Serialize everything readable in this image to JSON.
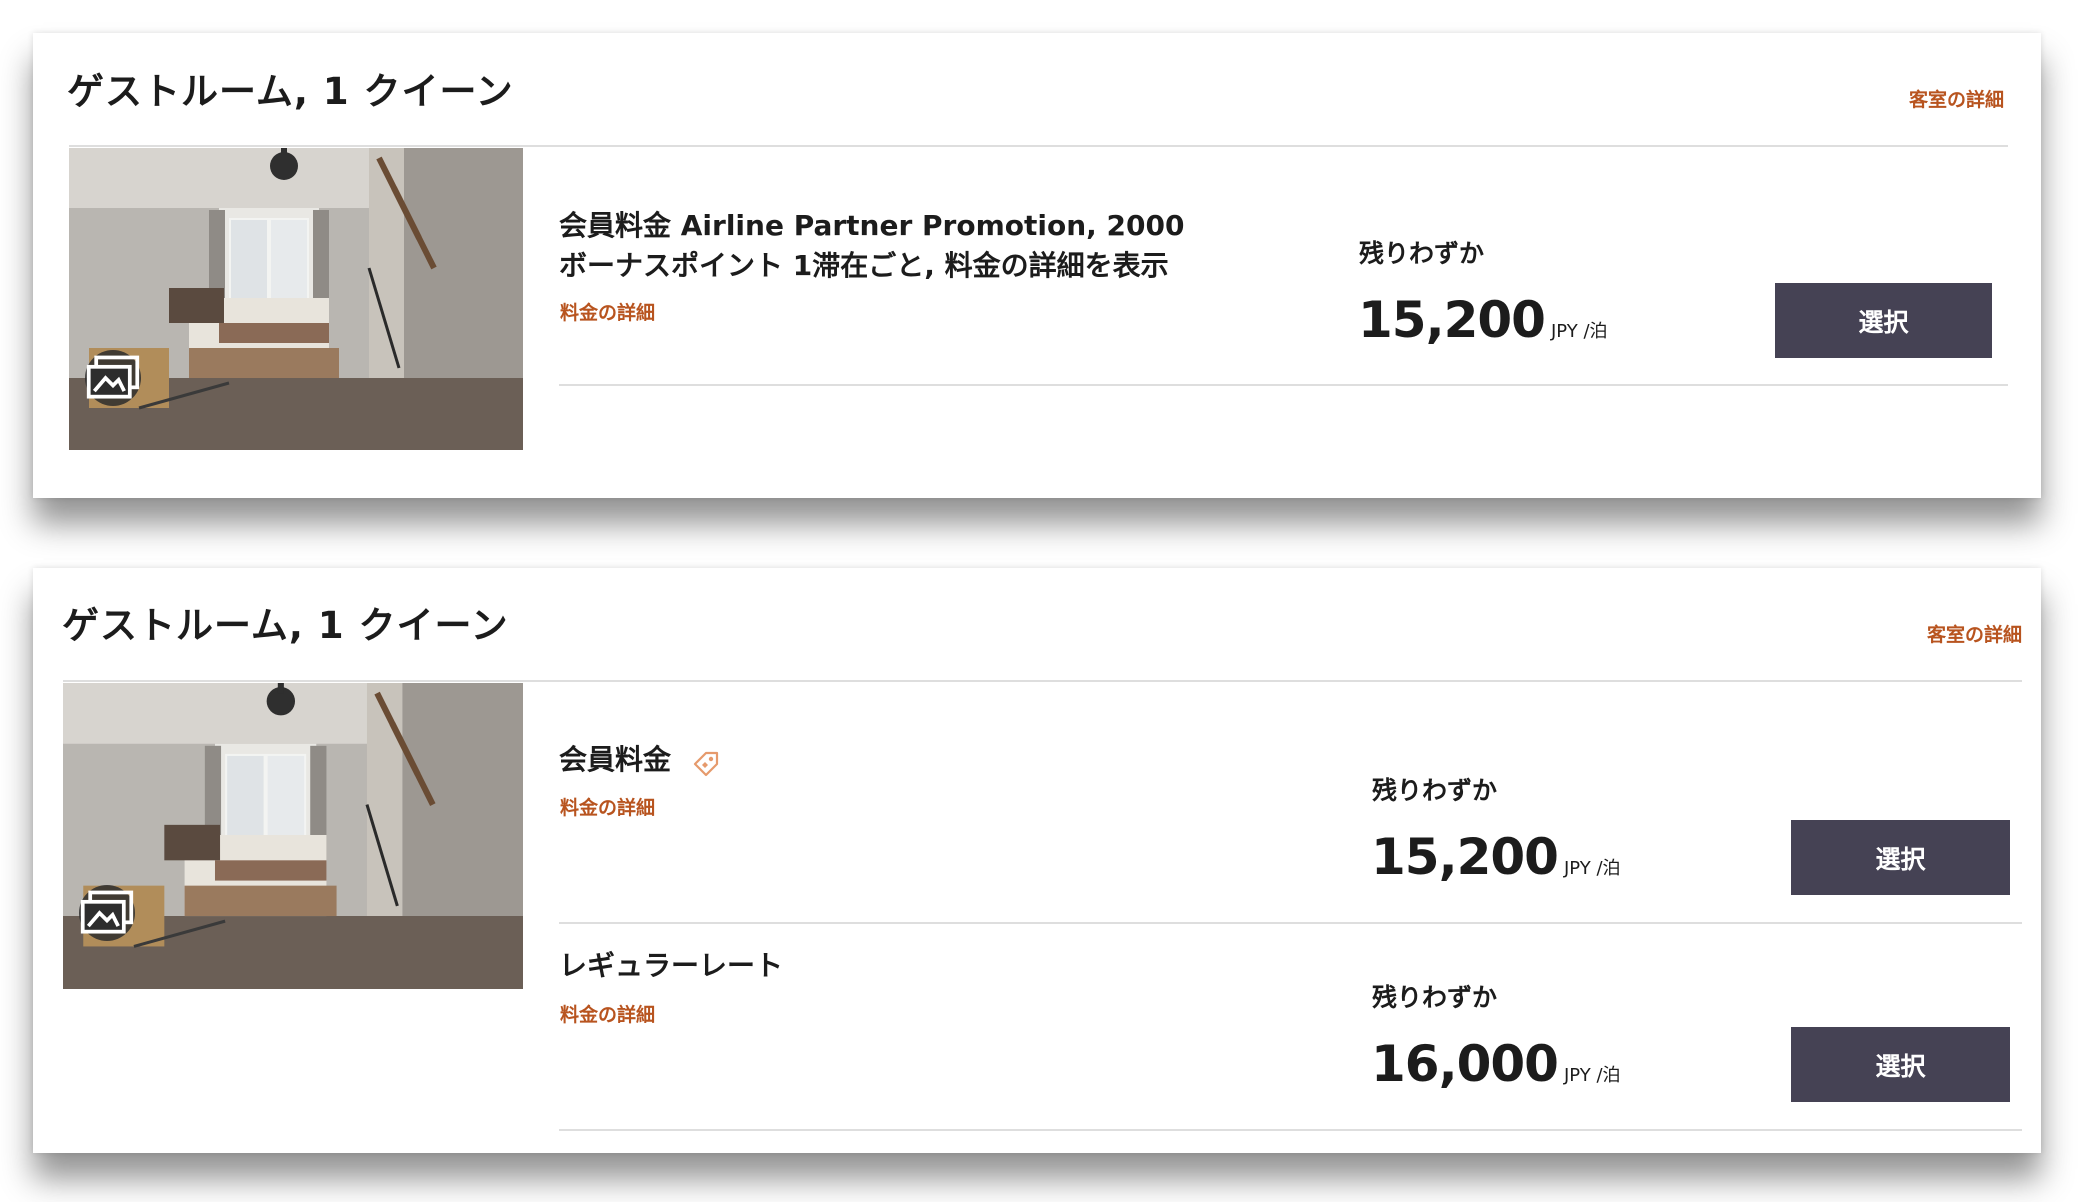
{
  "rooms": [
    {
      "title": "ゲストルーム, 1 クイーン",
      "details_link": "客室の詳細",
      "gallery_icon": "gallery-icon",
      "rates": [
        {
          "name": "会員料金 Airline Partner Promotion, 2000 ボーナスポイント 1滞在ごと, 料金の詳細を表示",
          "details_link": "料金の詳細",
          "availability": "残りわずか",
          "price": "15,200",
          "unit": "JPY /泊",
          "select_label": "選択"
        }
      ]
    },
    {
      "title": "ゲストルーム, 1 クイーン",
      "details_link": "客室の詳細",
      "gallery_icon": "gallery-icon",
      "rates": [
        {
          "name": "会員料金",
          "tag_icon": "member-tag-icon",
          "details_link": "料金の詳細",
          "availability": "残りわずか",
          "price": "15,200",
          "unit": "JPY /泊",
          "select_label": "選択"
        },
        {
          "name": "レギュラーレート",
          "details_link": "料金の詳細",
          "availability": "残りわずか",
          "price": "16,000",
          "unit": "JPY /泊",
          "select_label": "選択"
        }
      ]
    }
  ],
  "colors": {
    "accent_link": "#b8541f",
    "button_bg": "#454254",
    "divider": "#dedede"
  }
}
